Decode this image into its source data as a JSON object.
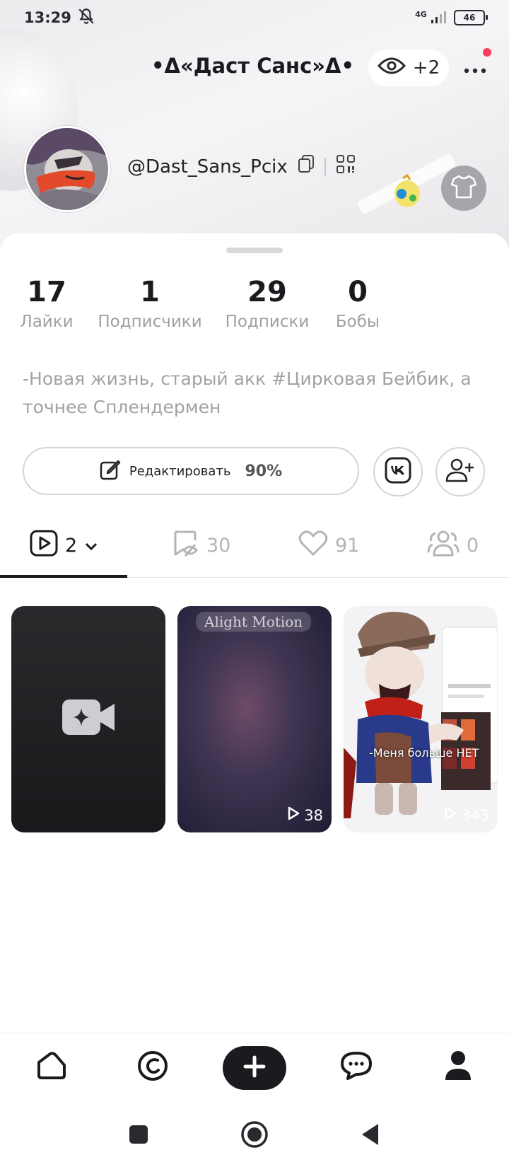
{
  "status_bar": {
    "time": "13:29",
    "network": "4G",
    "battery": "46"
  },
  "header": {
    "nickname": "•Δ«Даст Санс»Δ•",
    "views_count": "+2"
  },
  "profile": {
    "handle": "@Dast_Sans_Pcix"
  },
  "stats": [
    {
      "value": "17",
      "label": "Лайки"
    },
    {
      "value": "1",
      "label": "Подписчики"
    },
    {
      "value": "29",
      "label": "Подписки"
    },
    {
      "value": "0",
      "label": "Бобы"
    }
  ],
  "bio": "-Новая жизнь, старый акк #Цирковая Бейбик, а точнее Сплендермен",
  "actions": {
    "edit_label": "Редактировать",
    "edit_progress": "90%",
    "vk_label": "VK"
  },
  "tabs": [
    {
      "name": "videos",
      "count": "2",
      "icon": "play-square-icon"
    },
    {
      "name": "saved",
      "count": "30",
      "icon": "bookmark-hidden-icon"
    },
    {
      "name": "liked",
      "count": "91",
      "icon": "heart-icon"
    },
    {
      "name": "collabs",
      "count": "0",
      "icon": "people-icon"
    }
  ],
  "videos": [
    {
      "type": "placeholder",
      "icon": "video-camera-sparkle-icon"
    },
    {
      "type": "video",
      "watermark": "Alight Motion",
      "plays": "38"
    },
    {
      "type": "video",
      "caption": "-Меня больше НЕТ",
      "plays": "343"
    }
  ],
  "bottom_nav": [
    "home-icon",
    "discover-icon",
    "create-plus-icon",
    "messages-icon",
    "profile-icon"
  ],
  "colors": {
    "accent_badge": "#ff3b5c",
    "primary_text": "#1b1b1f",
    "muted_text": "#a3a1a5"
  }
}
